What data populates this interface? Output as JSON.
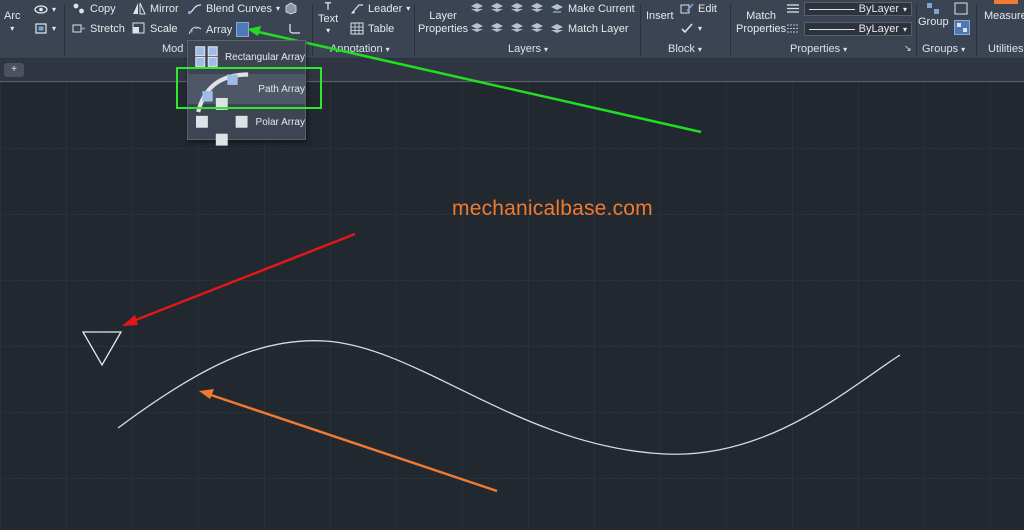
{
  "ribbon": {
    "draw": {
      "arc": "Arc"
    },
    "modify": {
      "copy": "Copy",
      "mirror": "Mirror",
      "blend_curves": "Blend Curves",
      "stretch": "Stretch",
      "scale": "Scale",
      "array": "Array",
      "panel": "Mod"
    },
    "annotation": {
      "text": "Text",
      "leader": "Leader",
      "table": "Table",
      "panel": "Annotation"
    },
    "layers": {
      "layer_properties_1": "Layer",
      "layer_properties_2": "Properties",
      "make_current": "Make Current",
      "match_layer": "Match Layer",
      "panel": "Layers"
    },
    "block": {
      "insert": "Insert",
      "edit": "Edit",
      "panel": "Block"
    },
    "properties": {
      "match_1": "Match",
      "match_2": "Properties",
      "bylayer_1": "ByLayer",
      "bylayer_2": "ByLayer",
      "panel": "Properties"
    },
    "groups": {
      "group": "Group",
      "panel": "Groups"
    },
    "utilities": {
      "measure": "Measure",
      "panel": "Utilities"
    }
  },
  "array_menu": {
    "items": [
      "Rectangular Array",
      "Path Array",
      "Polar Array"
    ],
    "selected": "Path Array"
  },
  "tabs": {
    "new_tab": "+"
  },
  "canvas": {
    "watermark": "mechanicalbase.com"
  },
  "colors": {
    "ribbon_bg": "#3b4453",
    "canvas_bg": "#212830",
    "grid": "#2e3742",
    "highlight": "#2ee82e",
    "arrow_green": "#22dd22",
    "arrow_red": "#e01818",
    "arrow_orange": "#f07a30",
    "watermark": "#f07a30"
  }
}
